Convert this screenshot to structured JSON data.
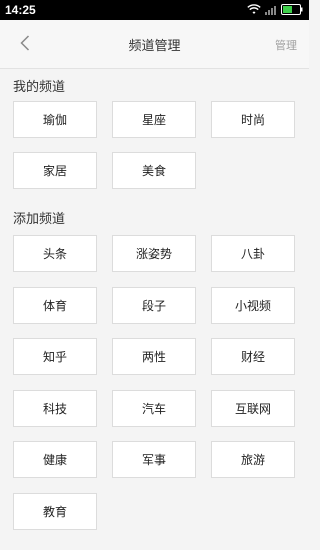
{
  "status_bar": {
    "time": "14:25"
  },
  "nav": {
    "title": "频道管理",
    "manage": "管理"
  },
  "my_channels": {
    "title": "我的频道",
    "items": [
      "瑜伽",
      "星座",
      "时尚",
      "家居",
      "美食"
    ]
  },
  "add_channels": {
    "title": "添加频道",
    "items": [
      "头条",
      "涨姿势",
      "八卦",
      "体育",
      "段子",
      "小视频",
      "知乎",
      "两性",
      "财经",
      "科技",
      "汽车",
      "互联网",
      "健康",
      "军事",
      "旅游",
      "教育"
    ]
  }
}
